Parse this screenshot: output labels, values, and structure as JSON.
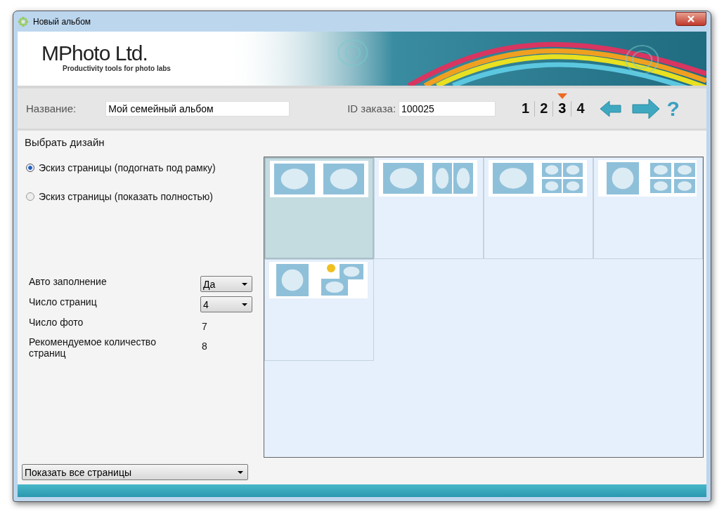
{
  "window": {
    "title": "Новый альбом"
  },
  "logo": {
    "name": "MPhoto Ltd.",
    "tagline": "Productivity tools for photo labs"
  },
  "toolbar": {
    "name_label": "Название:",
    "name_value": "Мой семейный альбом",
    "order_label": "ID заказа:",
    "order_value": "100025",
    "steps": [
      {
        "label": "1",
        "selected": false
      },
      {
        "label": "2",
        "selected": false
      },
      {
        "label": "3",
        "selected": true
      },
      {
        "label": "4",
        "selected": false
      }
    ],
    "help": "?"
  },
  "design": {
    "title": "Выбрать дизайн",
    "view_options": [
      {
        "label": "Эскиз страницы (подогнать под рамку)",
        "selected": true
      },
      {
        "label": "Эскиз страницы (показать полностью)",
        "selected": false
      }
    ],
    "settings": [
      {
        "kind": "dropdown",
        "label": "Авто заполнение",
        "value": "Да"
      },
      {
        "kind": "dropdown",
        "label": "Число страниц",
        "value": "4"
      },
      {
        "kind": "value",
        "label": "Число фото",
        "value": "7"
      },
      {
        "kind": "value",
        "label": "Рекомендуемое количество страниц",
        "value": "8"
      }
    ],
    "filter": "Показать все страницы",
    "layouts": [
      {
        "kind": "pair",
        "selected": true
      },
      {
        "kind": "one-two",
        "selected": false
      },
      {
        "kind": "one-four",
        "selected": false
      },
      {
        "kind": "square-four",
        "selected": false
      },
      {
        "kind": "collage",
        "selected": false
      }
    ]
  }
}
